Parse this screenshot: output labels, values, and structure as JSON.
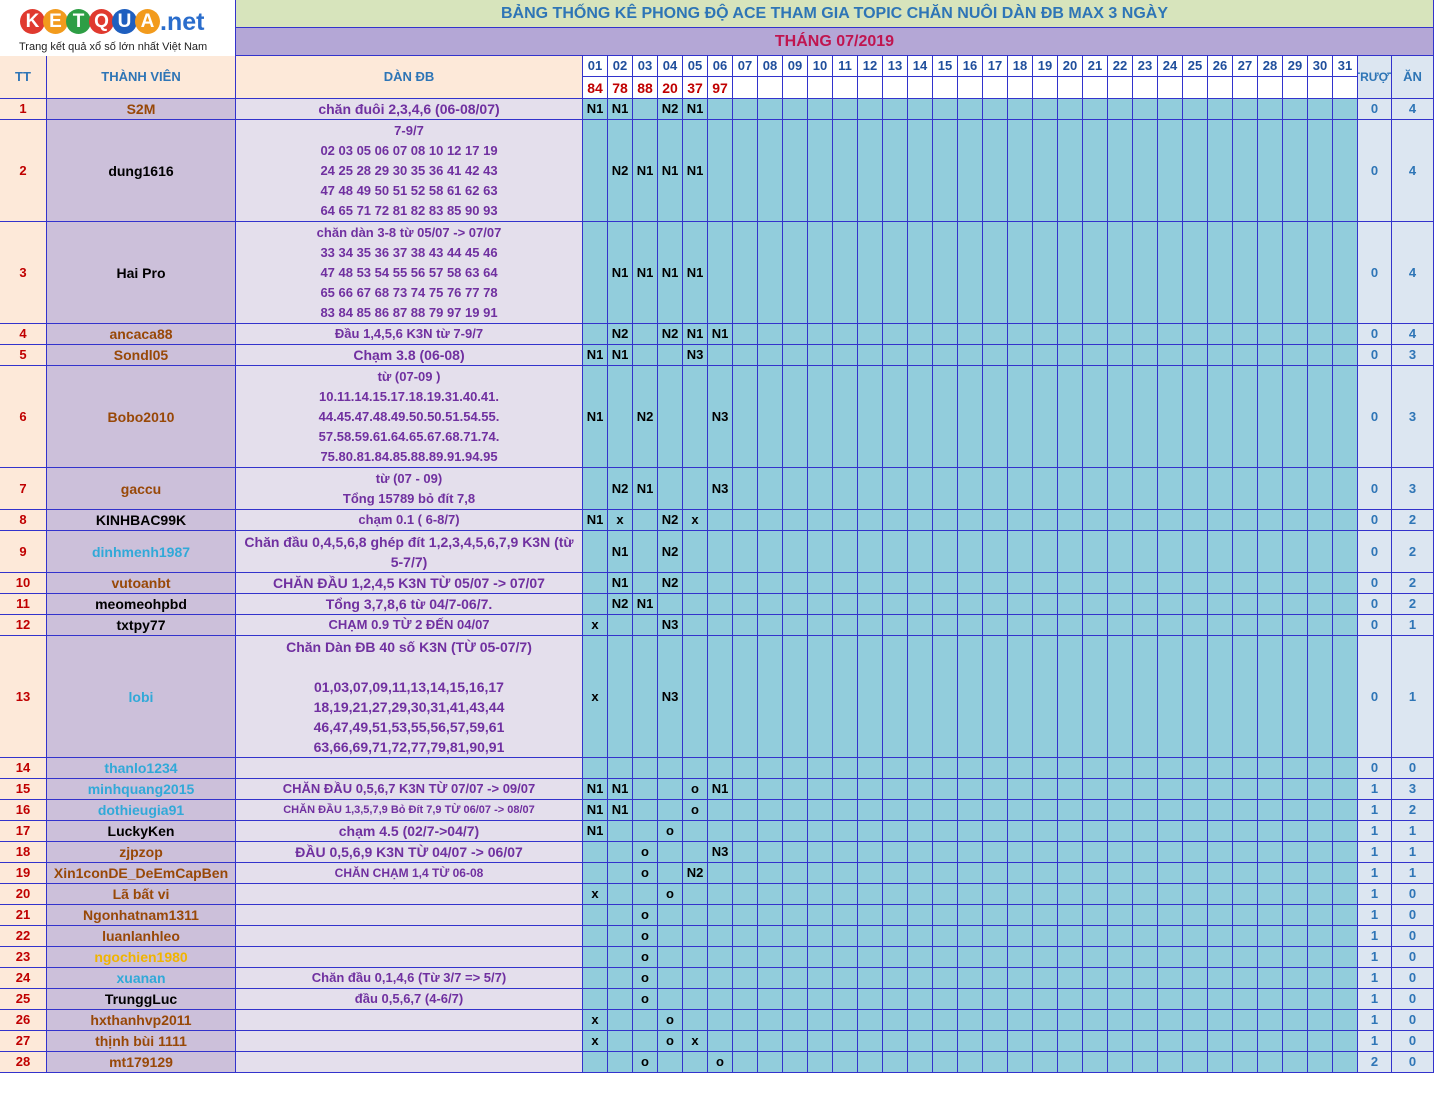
{
  "logo": {
    "letters": [
      "K",
      "E",
      "T",
      "Q",
      "U",
      "A"
    ],
    "colors": [
      "#e03a2f",
      "#f29b1d",
      "#2e9e45",
      "#e03a2f",
      "#1f5fbf",
      "#f29b1d"
    ],
    "suffix": ".net",
    "tagline": "Trang kết quả xổ số lớn nhất Việt Nam"
  },
  "title": "BẢNG THỐNG KÊ PHONG ĐỘ ACE THAM GIA TOPIC CHĂN NUÔI DÀN ĐB MAX 3 NGÀY",
  "month": "THÁNG 07/2019",
  "headers": {
    "tt": "TT",
    "member": "THÀNH VIÊN",
    "dan": "DÀN ĐB",
    "truot": "TRƯỢT",
    "an": "ĂN"
  },
  "days": [
    "01",
    "02",
    "03",
    "04",
    "05",
    "06",
    "07",
    "08",
    "09",
    "10",
    "11",
    "12",
    "13",
    "14",
    "15",
    "16",
    "17",
    "18",
    "19",
    "20",
    "21",
    "22",
    "23",
    "24",
    "25",
    "26",
    "27",
    "28",
    "29",
    "30",
    "31"
  ],
  "results": [
    "84",
    "78",
    "88",
    "20",
    "37",
    "97"
  ],
  "colors": {
    "title_bg": "#d7e4bc",
    "title_text": "#2e75b6",
    "month_bg": "#b4a7d6",
    "month_text": "#c0154f",
    "tt_bg": "#fde9d9",
    "member_bg": "#ccc0da",
    "dan_bg": "#e4dfec",
    "day_bg": "#92cddc",
    "day_header_text": "#1f4e9c",
    "result_text": "#c00000",
    "count_bg": "#dce6f1",
    "count_text": "#2e75b6",
    "tt_text": "#c00000",
    "dan_text": "#7030a0",
    "grid": "#3333cc"
  },
  "rows": [
    {
      "tt": "1",
      "name": "S2M",
      "color": "#984807",
      "dan": "chăn đuôi 2,3,4,6 (06-08/07)",
      "size": 14,
      "marks": [
        "N1",
        "N1",
        "",
        "N2",
        "N1",
        "",
        "",
        "",
        "",
        "",
        "",
        "",
        "",
        "",
        "",
        "",
        "",
        "",
        "",
        "",
        "",
        "",
        "",
        "",
        "",
        "",
        "",
        "",
        "",
        "",
        ""
      ],
      "truot": "0",
      "an": "4"
    },
    {
      "tt": "2",
      "name": "dung1616",
      "color": "#000000",
      "dan": "7-9/7\n02 03 05 06 07 08 10 12 17 19\n24 25 28 29 30 35 36 41 42 43\n47 48 49 50 51 52 58 61 62 63\n64 65 71 72 81 82 83 85 90 93",
      "size": 13,
      "marks": [
        "",
        "N2",
        "N1",
        "N1",
        "N1",
        "",
        "",
        "",
        "",
        "",
        "",
        "",
        "",
        "",
        "",
        "",
        "",
        "",
        "",
        "",
        "",
        "",
        "",
        "",
        "",
        "",
        "",
        "",
        "",
        "",
        ""
      ],
      "truot": "0",
      "an": "4"
    },
    {
      "tt": "3",
      "name": "Hai Pro",
      "color": "#000000",
      "dan": "chăn dàn 3-8 từ 05/07 -> 07/07\n33 34 35 36 37 38 43 44 45 46\n47 48 53 54 55 56 57 58 63 64\n65 66 67 68 73 74 75 76 77 78\n83 84 85 86 87 88 79 97 19 91",
      "size": 13,
      "marks": [
        "",
        "N1",
        "N1",
        "N1",
        "N1",
        "",
        "",
        "",
        "",
        "",
        "",
        "",
        "",
        "",
        "",
        "",
        "",
        "",
        "",
        "",
        "",
        "",
        "",
        "",
        "",
        "",
        "",
        "",
        "",
        "",
        ""
      ],
      "truot": "0",
      "an": "4"
    },
    {
      "tt": "4",
      "name": "ancaca88",
      "color": "#984807",
      "dan": "Đầu 1,4,5,6 K3N từ 7-9/7",
      "size": 13,
      "marks": [
        "",
        "N2",
        "",
        "N2",
        "N1",
        "N1",
        "",
        "",
        "",
        "",
        "",
        "",
        "",
        "",
        "",
        "",
        "",
        "",
        "",
        "",
        "",
        "",
        "",
        "",
        "",
        "",
        "",
        "",
        "",
        "",
        ""
      ],
      "truot": "0",
      "an": "4"
    },
    {
      "tt": "5",
      "name": "Sondl05",
      "color": "#984807",
      "dan": "Chạm 3.8 (06-08)",
      "size": 14,
      "marks": [
        "N1",
        "N1",
        "",
        "",
        "N3",
        "",
        "",
        "",
        "",
        "",
        "",
        "",
        "",
        "",
        "",
        "",
        "",
        "",
        "",
        "",
        "",
        "",
        "",
        "",
        "",
        "",
        "",
        "",
        "",
        "",
        ""
      ],
      "truot": "0",
      "an": "3"
    },
    {
      "tt": "6",
      "name": "Bobo2010",
      "color": "#984807",
      "dan": "từ (07-09 )\n10.11.14.15.17.18.19.31.40.41.\n44.45.47.48.49.50.50.51.54.55.\n57.58.59.61.64.65.67.68.71.74.\n75.80.81.84.85.88.89.91.94.95",
      "size": 13,
      "marks": [
        "N1",
        "",
        "N2",
        "",
        "",
        "N3",
        "",
        "",
        "",
        "",
        "",
        "",
        "",
        "",
        "",
        "",
        "",
        "",
        "",
        "",
        "",
        "",
        "",
        "",
        "",
        "",
        "",
        "",
        "",
        "",
        ""
      ],
      "truot": "0",
      "an": "3"
    },
    {
      "tt": "7",
      "name": "gaccu",
      "color": "#984807",
      "dan": "từ (07 - 09)\nTổng 15789 bỏ đít 7,8",
      "size": 13,
      "marks": [
        "",
        "N2",
        "N1",
        "",
        "",
        "N3",
        "",
        "",
        "",
        "",
        "",
        "",
        "",
        "",
        "",
        "",
        "",
        "",
        "",
        "",
        "",
        "",
        "",
        "",
        "",
        "",
        "",
        "",
        "",
        "",
        ""
      ],
      "truot": "0",
      "an": "3"
    },
    {
      "tt": "8",
      "name": "KINHBAC99K",
      "color": "#000000",
      "dan": "chạm 0.1 ( 6-8/7)",
      "size": 13,
      "marks": [
        "N1",
        "x",
        "",
        "N2",
        "x",
        "",
        "",
        "",
        "",
        "",
        "",
        "",
        "",
        "",
        "",
        "",
        "",
        "",
        "",
        "",
        "",
        "",
        "",
        "",
        "",
        "",
        "",
        "",
        "",
        "",
        ""
      ],
      "truot": "0",
      "an": "2"
    },
    {
      "tt": "9",
      "name": "dinhmenh1987",
      "color": "#31a9d8",
      "dan": "Chăn đầu 0,4,5,6,8 ghép đít 1,2,3,4,5,6,7,9 K3N (từ\n5-7/7)",
      "size": 14,
      "marks": [
        "",
        "N1",
        "",
        "N2",
        "",
        "",
        "",
        "",
        "",
        "",
        "",
        "",
        "",
        "",
        "",
        "",
        "",
        "",
        "",
        "",
        "",
        "",
        "",
        "",
        "",
        "",
        "",
        "",
        "",
        "",
        ""
      ],
      "truot": "0",
      "an": "2"
    },
    {
      "tt": "10",
      "name": "vutoanbt",
      "color": "#984807",
      "dan": "CHĂN ĐẦU 1,2,4,5 K3N TỪ 05/07 -> 07/07",
      "size": 14,
      "marks": [
        "",
        "N1",
        "",
        "N2",
        "",
        "",
        "",
        "",
        "",
        "",
        "",
        "",
        "",
        "",
        "",
        "",
        "",
        "",
        "",
        "",
        "",
        "",
        "",
        "",
        "",
        "",
        "",
        "",
        "",
        "",
        ""
      ],
      "truot": "0",
      "an": "2"
    },
    {
      "tt": "11",
      "name": "meomeohpbd",
      "color": "#000000",
      "dan": "Tổng 3,7,8,6 từ 04/7-06/7.",
      "size": 14,
      "marks": [
        "",
        "N2",
        "N1",
        "",
        "",
        "",
        "",
        "",
        "",
        "",
        "",
        "",
        "",
        "",
        "",
        "",
        "",
        "",
        "",
        "",
        "",
        "",
        "",
        "",
        "",
        "",
        "",
        "",
        "",
        "",
        ""
      ],
      "truot": "0",
      "an": "2"
    },
    {
      "tt": "12",
      "name": "txtpy77",
      "color": "#000000",
      "dan": "CHẠM 0.9 TỪ 2 ĐẾN 04/07",
      "size": 13,
      "marks": [
        "x",
        "",
        "",
        "N3",
        "",
        "",
        "",
        "",
        "",
        "",
        "",
        "",
        "",
        "",
        "",
        "",
        "",
        "",
        "",
        "",
        "",
        "",
        "",
        "",
        "",
        "",
        "",
        "",
        "",
        "",
        ""
      ],
      "truot": "0",
      "an": "1"
    },
    {
      "tt": "13",
      "name": "lobi",
      "color": "#31a9d8",
      "dan": "Chăn Dàn ĐB 40 số K3N (TỪ 05-07/7)\n\n01,03,07,09,11,13,14,15,16,17\n18,19,21,27,29,30,31,41,43,44\n46,47,49,51,53,55,56,57,59,61\n63,66,69,71,72,77,79,81,90,91",
      "size": 14,
      "marks": [
        "x",
        "",
        "",
        "N3",
        "",
        "",
        "",
        "",
        "",
        "",
        "",
        "",
        "",
        "",
        "",
        "",
        "",
        "",
        "",
        "",
        "",
        "",
        "",
        "",
        "",
        "",
        "",
        "",
        "",
        "",
        ""
      ],
      "truot": "0",
      "an": "1"
    },
    {
      "tt": "14",
      "name": "thanlo1234",
      "color": "#31a9d8",
      "dan": "",
      "size": 13,
      "marks": [
        "",
        "",
        "",
        "",
        "",
        "",
        "",
        "",
        "",
        "",
        "",
        "",
        "",
        "",
        "",
        "",
        "",
        "",
        "",
        "",
        "",
        "",
        "",
        "",
        "",
        "",
        "",
        "",
        "",
        "",
        ""
      ],
      "truot": "0",
      "an": "0"
    },
    {
      "tt": "15",
      "name": "minhquang2015",
      "color": "#31a9d8",
      "dan": "CHĂN ĐẦU 0,5,6,7 K3N TỪ 07/07 -> 09/07",
      "size": 13,
      "marks": [
        "N1",
        "N1",
        "",
        "",
        "o",
        "N1",
        "",
        "",
        "",
        "",
        "",
        "",
        "",
        "",
        "",
        "",
        "",
        "",
        "",
        "",
        "",
        "",
        "",
        "",
        "",
        "",
        "",
        "",
        "",
        "",
        ""
      ],
      "truot": "1",
      "an": "3"
    },
    {
      "tt": "16",
      "name": "dothieugia91",
      "color": "#31a9d8",
      "dan": "CHĂN ĐẦU 1,3,5,7,9 Bỏ Đít 7,9 TỪ 06/07 -> 08/07",
      "size": 11,
      "marks": [
        "N1",
        "N1",
        "",
        "",
        "o",
        "",
        "",
        "",
        "",
        "",
        "",
        "",
        "",
        "",
        "",
        "",
        "",
        "",
        "",
        "",
        "",
        "",
        "",
        "",
        "",
        "",
        "",
        "",
        "",
        "",
        ""
      ],
      "truot": "1",
      "an": "2"
    },
    {
      "tt": "17",
      "name": "LuckyKen",
      "color": "#000000",
      "dan": "chạm 4.5 (02/7->04/7)",
      "size": 14,
      "marks": [
        "N1",
        "",
        "",
        "o",
        "",
        "",
        "",
        "",
        "",
        "",
        "",
        "",
        "",
        "",
        "",
        "",
        "",
        "",
        "",
        "",
        "",
        "",
        "",
        "",
        "",
        "",
        "",
        "",
        "",
        "",
        ""
      ],
      "truot": "1",
      "an": "1"
    },
    {
      "tt": "18",
      "name": "zjpzop",
      "color": "#984807",
      "dan": "ĐẦU 0,5,6,9 K3N TỪ 04/07 -> 06/07",
      "size": 14,
      "marks": [
        "",
        "",
        "o",
        "",
        "",
        "N3",
        "",
        "",
        "",
        "",
        "",
        "",
        "",
        "",
        "",
        "",
        "",
        "",
        "",
        "",
        "",
        "",
        "",
        "",
        "",
        "",
        "",
        "",
        "",
        "",
        ""
      ],
      "truot": "1",
      "an": "1"
    },
    {
      "tt": "19",
      "name": "Xin1conDE_DeEmCapBen",
      "color": "#984807",
      "dan": "CHĂN CHẠM 1,4 TỪ 06-08",
      "size": 12,
      "marks": [
        "",
        "",
        "o",
        "",
        "N2",
        "",
        "",
        "",
        "",
        "",
        "",
        "",
        "",
        "",
        "",
        "",
        "",
        "",
        "",
        "",
        "",
        "",
        "",
        "",
        "",
        "",
        "",
        "",
        "",
        "",
        ""
      ],
      "truot": "1",
      "an": "1"
    },
    {
      "tt": "20",
      "name": "Lã bất vi",
      "color": "#984807",
      "dan": "",
      "size": 13,
      "marks": [
        "x",
        "",
        "",
        "o",
        "",
        "",
        "",
        "",
        "",
        "",
        "",
        "",
        "",
        "",
        "",
        "",
        "",
        "",
        "",
        "",
        "",
        "",
        "",
        "",
        "",
        "",
        "",
        "",
        "",
        "",
        ""
      ],
      "truot": "1",
      "an": "0"
    },
    {
      "tt": "21",
      "name": "Ngonhatnam1311",
      "color": "#984807",
      "dan": "",
      "size": 13,
      "marks": [
        "",
        "",
        "o",
        "",
        "",
        "",
        "",
        "",
        "",
        "",
        "",
        "",
        "",
        "",
        "",
        "",
        "",
        "",
        "",
        "",
        "",
        "",
        "",
        "",
        "",
        "",
        "",
        "",
        "",
        "",
        ""
      ],
      "truot": "1",
      "an": "0"
    },
    {
      "tt": "22",
      "name": "luanlanhleo",
      "color": "#984807",
      "dan": "",
      "size": 13,
      "marks": [
        "",
        "",
        "o",
        "",
        "",
        "",
        "",
        "",
        "",
        "",
        "",
        "",
        "",
        "",
        "",
        "",
        "",
        "",
        "",
        "",
        "",
        "",
        "",
        "",
        "",
        "",
        "",
        "",
        "",
        "",
        ""
      ],
      "truot": "1",
      "an": "0"
    },
    {
      "tt": "23",
      "name": "ngochien1980",
      "color": "#f0b400",
      "dan": "",
      "size": 13,
      "marks": [
        "",
        "",
        "o",
        "",
        "",
        "",
        "",
        "",
        "",
        "",
        "",
        "",
        "",
        "",
        "",
        "",
        "",
        "",
        "",
        "",
        "",
        "",
        "",
        "",
        "",
        "",
        "",
        "",
        "",
        "",
        ""
      ],
      "truot": "1",
      "an": "0"
    },
    {
      "tt": "24",
      "name": "xuanan",
      "color": "#31a9d8",
      "dan": "Chăn đầu 0,1,4,6 (Từ 3/7 => 5/7)",
      "size": 13,
      "marks": [
        "",
        "",
        "o",
        "",
        "",
        "",
        "",
        "",
        "",
        "",
        "",
        "",
        "",
        "",
        "",
        "",
        "",
        "",
        "",
        "",
        "",
        "",
        "",
        "",
        "",
        "",
        "",
        "",
        "",
        "",
        ""
      ],
      "truot": "1",
      "an": "0"
    },
    {
      "tt": "25",
      "name": "TrunggLuc",
      "color": "#000000",
      "dan": "đầu 0,5,6,7 (4-6/7)",
      "size": 13,
      "marks": [
        "",
        "",
        "o",
        "",
        "",
        "",
        "",
        "",
        "",
        "",
        "",
        "",
        "",
        "",
        "",
        "",
        "",
        "",
        "",
        "",
        "",
        "",
        "",
        "",
        "",
        "",
        "",
        "",
        "",
        "",
        ""
      ],
      "truot": "1",
      "an": "0"
    },
    {
      "tt": "26",
      "name": "hxthanhvp2011",
      "color": "#984807",
      "dan": "",
      "size": 13,
      "marks": [
        "x",
        "",
        "",
        "o",
        "",
        "",
        "",
        "",
        "",
        "",
        "",
        "",
        "",
        "",
        "",
        "",
        "",
        "",
        "",
        "",
        "",
        "",
        "",
        "",
        "",
        "",
        "",
        "",
        "",
        "",
        ""
      ],
      "truot": "1",
      "an": "0"
    },
    {
      "tt": "27",
      "name": "thịnh bùi 1111",
      "color": "#984807",
      "dan": "",
      "size": 13,
      "marks": [
        "x",
        "",
        "",
        "o",
        "x",
        "",
        "",
        "",
        "",
        "",
        "",
        "",
        "",
        "",
        "",
        "",
        "",
        "",
        "",
        "",
        "",
        "",
        "",
        "",
        "",
        "",
        "",
        "",
        "",
        "",
        ""
      ],
      "truot": "1",
      "an": "0"
    },
    {
      "tt": "28",
      "name": "mt179129",
      "color": "#984807",
      "dan": "",
      "size": 13,
      "marks": [
        "",
        "",
        "o",
        "",
        "",
        "o",
        "",
        "",
        "",
        "",
        "",
        "",
        "",
        "",
        "",
        "",
        "",
        "",
        "",
        "",
        "",
        "",
        "",
        "",
        "",
        "",
        "",
        "",
        "",
        "",
        ""
      ],
      "truot": "2",
      "an": "0"
    }
  ]
}
